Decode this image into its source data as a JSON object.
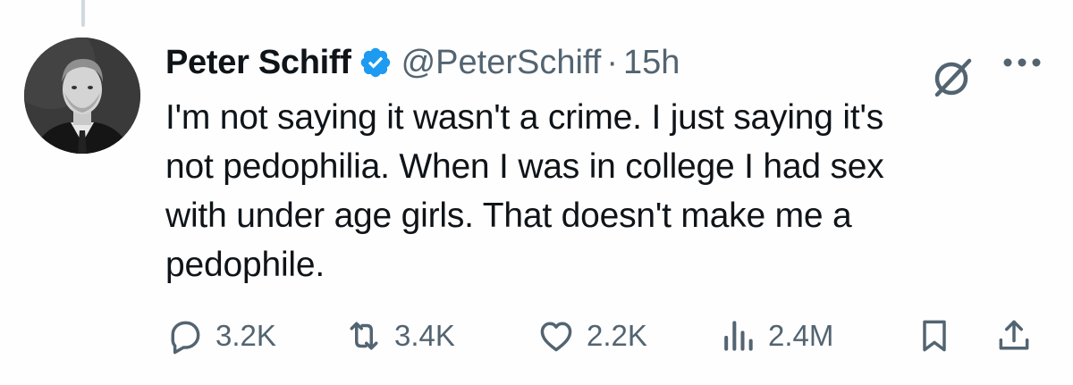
{
  "tweet": {
    "author": {
      "display_name": "Peter Schiff",
      "handle": "@PeterSchiff",
      "verified": true
    },
    "separator": "·",
    "time": "15h",
    "text": "I'm not saying it wasn't a crime.  I just saying it's\nnot pedophilia. When I was in college I had sex\nwith under age girls. That doesn't make me a\npedophile.",
    "stats": {
      "replies": "3.2K",
      "reposts": "3.4K",
      "likes": "2.2K",
      "views": "2.4M"
    }
  },
  "icons": {
    "verified": "verified-badge-icon",
    "grok": "grok-icon",
    "more": "more-icon",
    "reply": "reply-icon",
    "repost": "repost-icon",
    "like": "heart-icon",
    "views": "views-icon",
    "bookmark": "bookmark-icon",
    "share": "share-icon"
  },
  "colors": {
    "text": "#0f1419",
    "secondary": "#536471",
    "verified": "#1d9bf0",
    "thread_line": "#cfd9de"
  }
}
